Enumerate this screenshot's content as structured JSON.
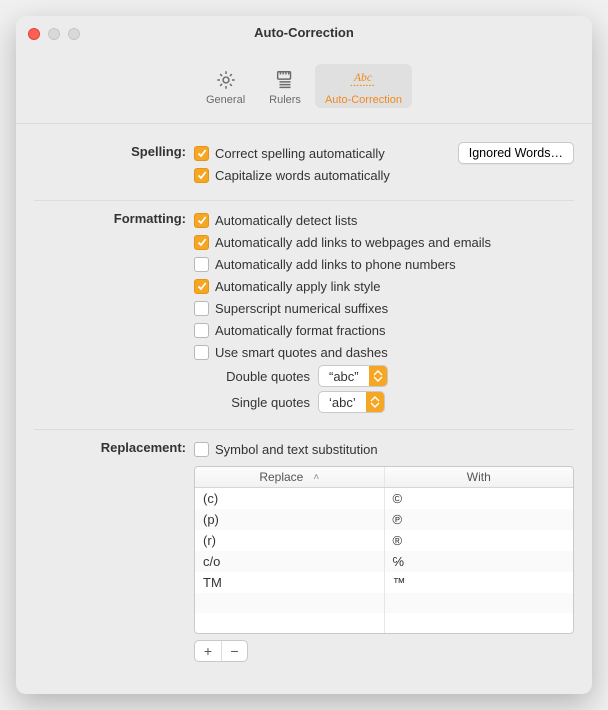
{
  "window": {
    "title": "Auto-Correction"
  },
  "toolbar": {
    "tabs": [
      {
        "id": "general",
        "label": "General"
      },
      {
        "id": "rulers",
        "label": "Rulers"
      },
      {
        "id": "auto",
        "label": "Auto-Correction"
      }
    ]
  },
  "spelling": {
    "heading": "Spelling:",
    "opts": [
      {
        "label": "Correct spelling automatically",
        "checked": true
      },
      {
        "label": "Capitalize words automatically",
        "checked": true
      }
    ],
    "ignored_btn": "Ignored Words…"
  },
  "formatting": {
    "heading": "Formatting:",
    "opts": [
      {
        "label": "Automatically detect lists",
        "checked": true
      },
      {
        "label": "Automatically add links to webpages and emails",
        "checked": true
      },
      {
        "label": "Automatically add links to phone numbers",
        "checked": false
      },
      {
        "label": "Automatically apply link style",
        "checked": true
      },
      {
        "label": "Superscript numerical suffixes",
        "checked": false
      },
      {
        "label": "Automatically format fractions",
        "checked": false
      },
      {
        "label": "Use smart quotes and dashes",
        "checked": false
      }
    ],
    "double_label": "Double quotes",
    "double_value": "“abc”",
    "single_label": "Single quotes",
    "single_value": "‘abc’"
  },
  "replacement": {
    "heading": "Replacement:",
    "opt": {
      "label": "Symbol and text substitution",
      "checked": false
    },
    "columns": {
      "c1": "Replace",
      "c2": "With"
    },
    "rows": [
      {
        "r": "(c)",
        "w": "©"
      },
      {
        "r": "(p)",
        "w": "℗"
      },
      {
        "r": "(r)",
        "w": "®"
      },
      {
        "r": "c/o",
        "w": "℅"
      },
      {
        "r": "TM",
        "w": "™"
      }
    ],
    "add": "+",
    "remove": "−"
  }
}
